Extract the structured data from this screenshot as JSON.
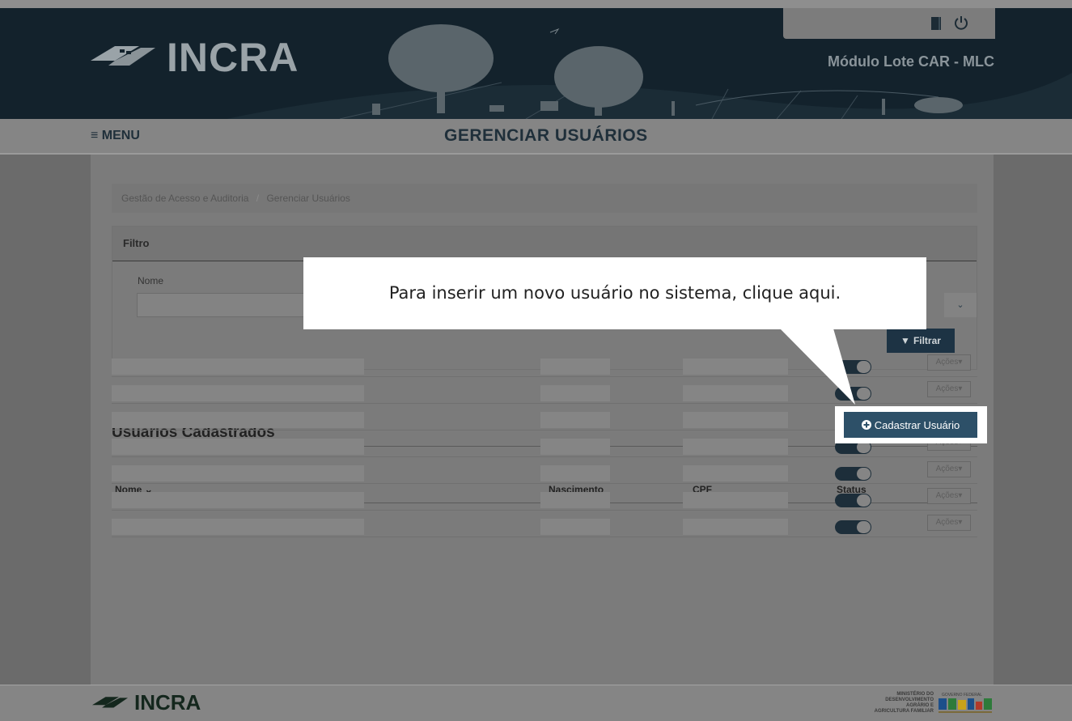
{
  "header": {
    "logo_text": "INCRA",
    "module_title": "Módulo Lote CAR - MLC",
    "user_bar": {
      "icons": [
        "book-icon",
        "power-icon"
      ]
    }
  },
  "subnav": {
    "menu_label": "MENU",
    "page_title": "GERENCIAR USUÁRIOS"
  },
  "breadcrumb": [
    "Gestão de Acesso e Auditoria",
    "Gerenciar Usuários"
  ],
  "filter": {
    "title": "Filtro",
    "name_label": "Nome",
    "name_value": "",
    "filter_button": "Filtrar"
  },
  "users_section": {
    "title": "Usuários Cadastrados",
    "register_button": "Cadastrar Usuário",
    "columns": [
      "Nome",
      "Nascimento",
      "CPF",
      "Status"
    ],
    "row_action_label": "Ações",
    "rows": [
      {
        "status": "on"
      },
      {
        "status": "on"
      },
      {
        "status": "on"
      },
      {
        "status": "on"
      },
      {
        "status": "on"
      },
      {
        "status": "on"
      },
      {
        "status": "on"
      }
    ]
  },
  "tooltip": {
    "text": "Para inserir um novo usuário no sistema, clique aqui."
  },
  "footer": {
    "logo_text": "INCRA",
    "ministry_text": "MINISTÉRIO DO DESENVOLVIMENTO AGRÁRIO E AGRICULTURA FAMILIAR",
    "gov_label": "GOVERNO FEDERAL",
    "brasil_label": "BRASIL"
  },
  "colors": {
    "header_bg": "#13222c",
    "accent_button": "#2d5068",
    "filter_button": "#1d3344",
    "overlay_tint": "#7b7b7b"
  }
}
